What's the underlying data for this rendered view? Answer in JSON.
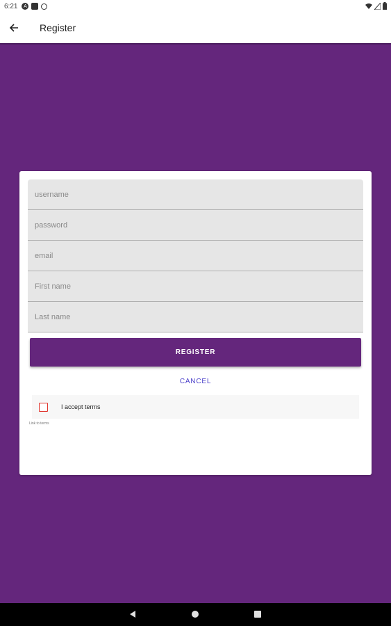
{
  "status_bar": {
    "time": "6:21",
    "left_icons": [
      "a-icon",
      "sim-icon",
      "settings-icon"
    ],
    "right_icons": [
      "wifi-icon",
      "signal-icon",
      "battery-icon"
    ]
  },
  "app_bar": {
    "title": "Register",
    "back_icon": "arrow-back-icon"
  },
  "form": {
    "fields": [
      {
        "name": "username",
        "placeholder": "username",
        "value": ""
      },
      {
        "name": "password",
        "placeholder": "password",
        "value": ""
      },
      {
        "name": "email",
        "placeholder": "email",
        "value": ""
      },
      {
        "name": "first_name",
        "placeholder": "First name",
        "value": ""
      },
      {
        "name": "last_name",
        "placeholder": "Last name",
        "value": ""
      }
    ],
    "register_label": "REGISTER",
    "cancel_label": "CANCEL",
    "terms_label": "I accept terms",
    "terms_checked": false,
    "terms_link_label": "Link to terms"
  },
  "colors": {
    "primary": "#64267c",
    "accent": "#4a3fc9",
    "checkbox_border": "#e0352d"
  },
  "nav_bar": {
    "items": [
      "back-triangle-icon",
      "home-circle-icon",
      "recents-square-icon"
    ]
  }
}
